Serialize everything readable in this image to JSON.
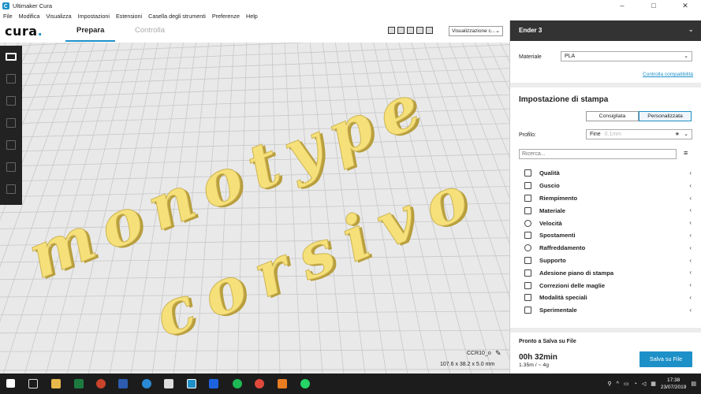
{
  "window": {
    "title": "Ultimaker Cura",
    "controls": [
      "–",
      "□",
      "✕"
    ]
  },
  "menu": [
    "File",
    "Modifica",
    "Visualizza",
    "Impostazioni",
    "Estensioni",
    "Casella degli strumenti",
    "Preferenze",
    "Help"
  ],
  "header": {
    "logo": "cura",
    "logo_dot": ".",
    "tabs": [
      {
        "label": "Prepara",
        "active": true
      },
      {
        "label": "Controlla",
        "active": false
      }
    ],
    "view_select": "Visualizzazione c..."
  },
  "viewport": {
    "model_text_line1": "monotype",
    "model_text_line2": "corsivo",
    "model_color": "#f6e07a",
    "object_name": "CCR10_o",
    "object_dimensions": "107.6 x 38.2 x 5.0 mm"
  },
  "right_panel": {
    "printer": "Ender 3",
    "material_label": "Materiale",
    "material_value": "PLA",
    "compat_link": "Controlla compatibilità",
    "settings_title": "Impostazione di stampa",
    "mode_buttons": [
      "Consigliata",
      "Personalizzata"
    ],
    "profile_label": "Profilo:",
    "profile_value": "Fine",
    "profile_sub": "0.1mm",
    "search_placeholder": "Ricerca...",
    "categories": [
      "Qualità",
      "Guscio",
      "Riempimento",
      "Materiale",
      "Velocità",
      "Spostamenti",
      "Raffreddamento",
      "Supporto",
      "Adesione piano di stampa",
      "Correzioni delle maglie",
      "Modalità speciali",
      "Sperimentale"
    ],
    "output_title": "Pronto a Salva su File",
    "print_time": "00h 32min",
    "print_material": "1.35m / ~ 4g",
    "save_button": "Salva su File"
  },
  "taskbar": {
    "time": "17:38",
    "date": "23/07/2019",
    "accent": "#1e90c8"
  }
}
